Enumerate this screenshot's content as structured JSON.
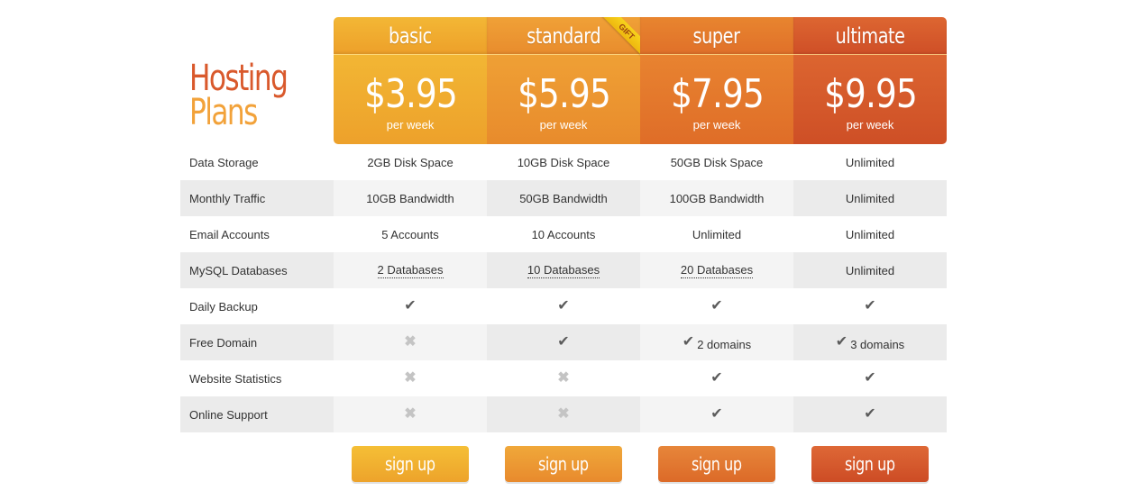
{
  "title": {
    "line1": "Hosting",
    "line2": "Plans"
  },
  "colors": {
    "title_primary": "#d9592c",
    "title_secondary": "#f2a23a",
    "check": "#5b5b5b",
    "cross": "#c4c4c4"
  },
  "plans": [
    {
      "name": "basic",
      "price": "$3.95",
      "period": "per week",
      "button": "sign up"
    },
    {
      "name": "standard",
      "price": "$5.95",
      "period": "per week",
      "button": "sign up",
      "badge": "GIFT"
    },
    {
      "name": "super",
      "price": "$7.95",
      "period": "per week",
      "button": "sign up"
    },
    {
      "name": "ultimate",
      "price": "$9.95",
      "period": "per week",
      "button": "sign up"
    }
  ],
  "features": [
    {
      "label": "Data Storage",
      "values": [
        {
          "type": "text",
          "text": "2GB Disk Space"
        },
        {
          "type": "text",
          "text": "10GB Disk Space"
        },
        {
          "type": "text",
          "text": "50GB Disk Space"
        },
        {
          "type": "text",
          "text": "Unlimited"
        }
      ]
    },
    {
      "label": "Monthly Traffic",
      "values": [
        {
          "type": "text",
          "text": "10GB Bandwidth"
        },
        {
          "type": "text",
          "text": "50GB Bandwidth"
        },
        {
          "type": "text",
          "text": "100GB Bandwidth"
        },
        {
          "type": "text",
          "text": "Unlimited"
        }
      ]
    },
    {
      "label": "Email Accounts",
      "values": [
        {
          "type": "text",
          "text": "5 Accounts"
        },
        {
          "type": "text",
          "text": "10 Accounts"
        },
        {
          "type": "text",
          "text": "Unlimited"
        },
        {
          "type": "text",
          "text": "Unlimited"
        }
      ]
    },
    {
      "label": "MySQL Databases",
      "values": [
        {
          "type": "tooltip",
          "text": "2 Databases"
        },
        {
          "type": "tooltip",
          "text": "10 Databases"
        },
        {
          "type": "tooltip",
          "text": "20 Databases"
        },
        {
          "type": "text",
          "text": "Unlimited"
        }
      ]
    },
    {
      "label": "Daily Backup",
      "values": [
        {
          "type": "check"
        },
        {
          "type": "check"
        },
        {
          "type": "check"
        },
        {
          "type": "check"
        }
      ]
    },
    {
      "label": "Free Domain",
      "values": [
        {
          "type": "cross"
        },
        {
          "type": "check"
        },
        {
          "type": "check",
          "text": "2 domains"
        },
        {
          "type": "check",
          "text": "3 domains"
        }
      ]
    },
    {
      "label": "Website Statistics",
      "values": [
        {
          "type": "cross"
        },
        {
          "type": "cross"
        },
        {
          "type": "check"
        },
        {
          "type": "check"
        }
      ]
    },
    {
      "label": "Online Support",
      "values": [
        {
          "type": "cross"
        },
        {
          "type": "cross"
        },
        {
          "type": "check"
        },
        {
          "type": "check"
        }
      ]
    }
  ],
  "icons": {
    "check": "✔",
    "cross": "✖"
  }
}
